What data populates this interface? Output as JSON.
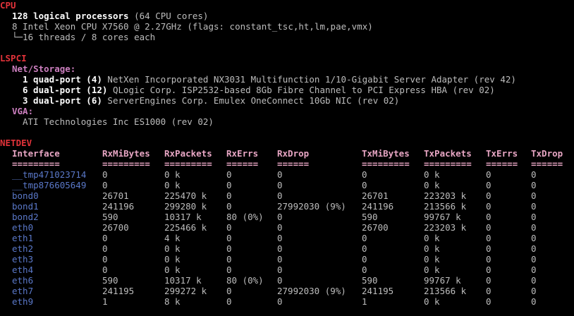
{
  "cpu": {
    "heading": "CPU",
    "summary_bold": "128 logical processors",
    "summary_rest": " (64 CPU cores)",
    "model_line": "8 Intel Xeon CPU X7560 @ 2.27GHz (flags: constant_tsc,ht,lm,pae,vmx)",
    "threads_line": "└─16 threads / 8 cores each"
  },
  "lspci": {
    "heading": "LSPCI",
    "net_storage_label": "Net/Storage:",
    "devices": [
      {
        "count": "1 quad-port (4)",
        "desc": " NetXen Incorporated NX3031 Multifunction 1/10-Gigabit Server Adapter (rev 42)"
      },
      {
        "count": "6 dual-port (12)",
        "desc": " QLogic Corp. ISP2532-based 8Gb Fibre Channel to PCI Express HBA (rev 02)"
      },
      {
        "count": "3 dual-port (6)",
        "desc": " ServerEngines Corp. Emulex OneConnect 10Gb NIC (rev 02)"
      }
    ],
    "vga_label": "VGA:",
    "vga_device": "ATI Technologies Inc ES1000 (rev 02)"
  },
  "netdev": {
    "heading": "NETDEV",
    "columns": [
      "Interface",
      "RxMiBytes",
      "RxPackets",
      "RxErrs",
      "RxDrop",
      "TxMiBytes",
      "TxPackets",
      "TxErrs",
      "TxDrop"
    ],
    "separators": [
      "=========",
      "=========",
      "=========",
      "======",
      "======",
      "=========",
      "=========",
      "======",
      "======"
    ],
    "rows": [
      [
        "__tmp471023714",
        "0",
        "0 k",
        "0",
        "0",
        "0",
        "0 k",
        "0",
        "0"
      ],
      [
        "__tmp876605649",
        "0",
        "0 k",
        "0",
        "0",
        "0",
        "0 k",
        "0",
        "0"
      ],
      [
        "bond0",
        "26701",
        "225470 k",
        "0",
        "0",
        "26701",
        "223203 k",
        "0",
        "0"
      ],
      [
        "bond1",
        "241196",
        "299280 k",
        "0",
        "27992030 (9%)",
        "241196",
        "213566 k",
        "0",
        "0"
      ],
      [
        "bond2",
        "590",
        "10317 k",
        "80 (0%)",
        "0",
        "590",
        "99767 k",
        "0",
        "0"
      ],
      [
        "eth0",
        "26700",
        "225466 k",
        "0",
        "0",
        "26700",
        "223203 k",
        "0",
        "0"
      ],
      [
        "eth1",
        "0",
        "4 k",
        "0",
        "0",
        "0",
        "0 k",
        "0",
        "0"
      ],
      [
        "eth2",
        "0",
        "0 k",
        "0",
        "0",
        "0",
        "0 k",
        "0",
        "0"
      ],
      [
        "eth3",
        "0",
        "0 k",
        "0",
        "0",
        "0",
        "0 k",
        "0",
        "0"
      ],
      [
        "eth4",
        "0",
        "0 k",
        "0",
        "0",
        "0",
        "0 k",
        "0",
        "0"
      ],
      [
        "eth6",
        "590",
        "10317 k",
        "80 (0%)",
        "0",
        "590",
        "99767 k",
        "0",
        "0"
      ],
      [
        "eth7",
        "241195",
        "299272 k",
        "0",
        "27992030 (9%)",
        "241195",
        "213566 k",
        "0",
        "0"
      ],
      [
        "eth9",
        "1",
        "8 k",
        "0",
        "0",
        "1",
        "0 k",
        "0",
        "0"
      ]
    ]
  },
  "colors": {
    "background": "#000000",
    "heading": "#e2333a",
    "subheading": "#cc7fbf",
    "interface": "#5a78c8",
    "table_header": "#e8a6c4",
    "text": "#bdbdbd"
  }
}
